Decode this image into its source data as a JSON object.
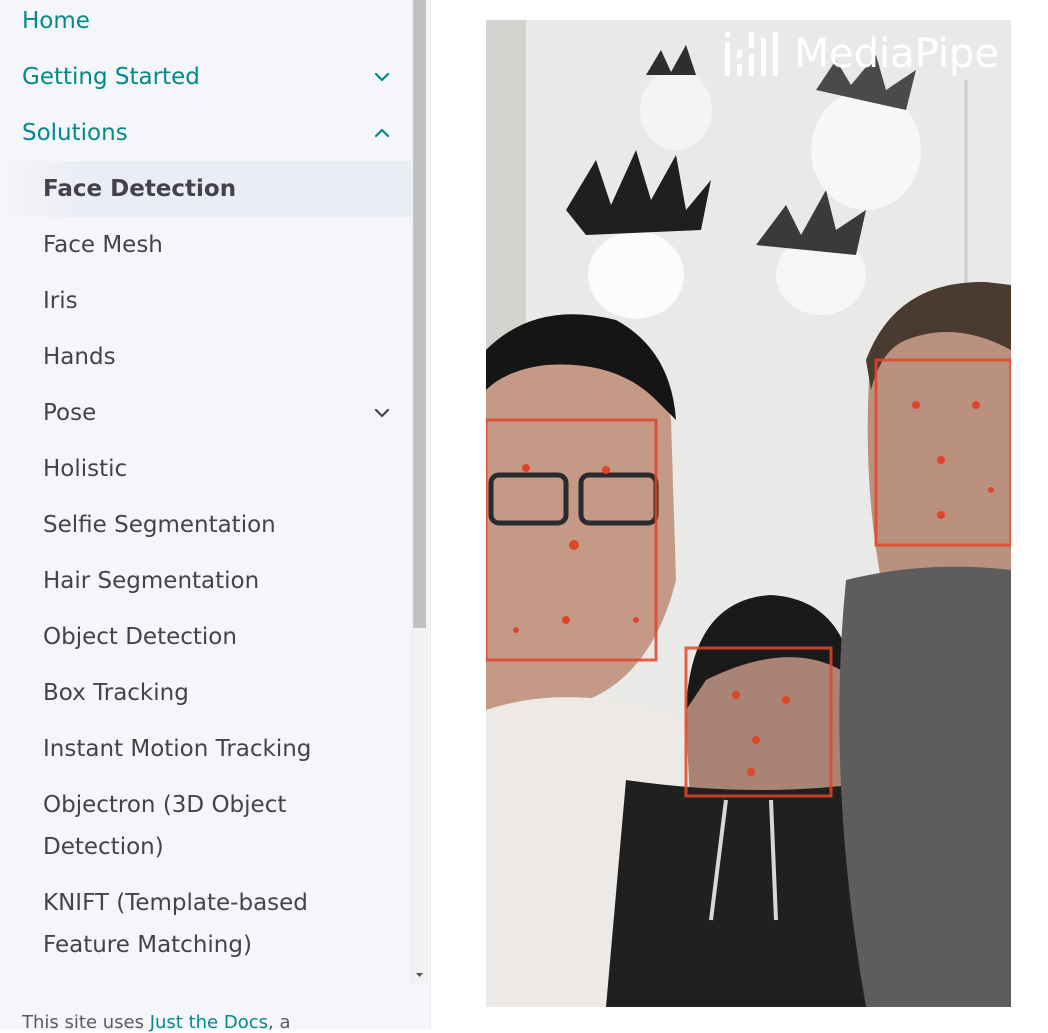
{
  "nav": {
    "home": "Home",
    "getting_started": "Getting Started",
    "solutions": "Solutions",
    "items": [
      "Face Detection",
      "Face Mesh",
      "Iris",
      "Hands",
      "Pose",
      "Holistic",
      "Selfie Segmentation",
      "Hair Segmentation",
      "Object Detection",
      "Box Tracking",
      "Instant Motion Tracking",
      "Objectron (3D Object Detection)",
      "KNIFT (Template-based Feature Matching)"
    ]
  },
  "footer": {
    "prefix": "This site uses ",
    "link": "Just the Docs",
    "suffix": ", a"
  },
  "figure": {
    "watermark": "MediaPipe"
  },
  "colors": {
    "link": "#008a8a",
    "text": "#44434d",
    "sidebar_bg": "#f5f6fa",
    "detection_box": "#e0452a"
  }
}
